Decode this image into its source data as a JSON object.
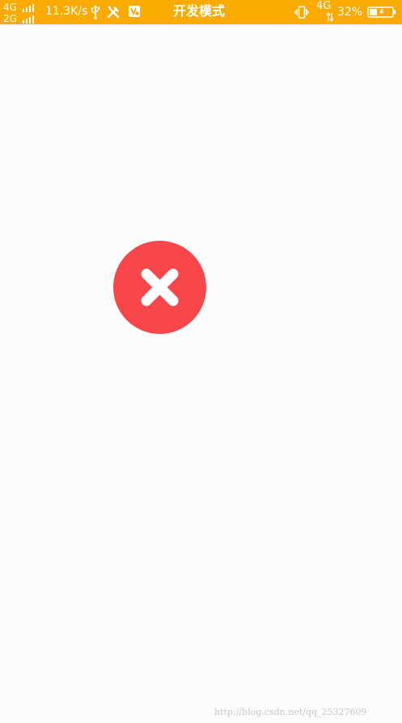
{
  "status_bar": {
    "background": "#fbab00",
    "network_1": "4G",
    "network_2": "2G",
    "speed": "11.3K/s",
    "title": "开发模式",
    "network_right": "4G",
    "battery": "32%",
    "icons": [
      "usb-icon",
      "tools-icon",
      "app-notification-icon",
      "vibrate-icon",
      "battery-icon"
    ]
  },
  "main": {
    "error_icon": "close-icon",
    "error_color": "#f8464b"
  },
  "watermark": "http://blog.csdn.net/qq_25327609"
}
